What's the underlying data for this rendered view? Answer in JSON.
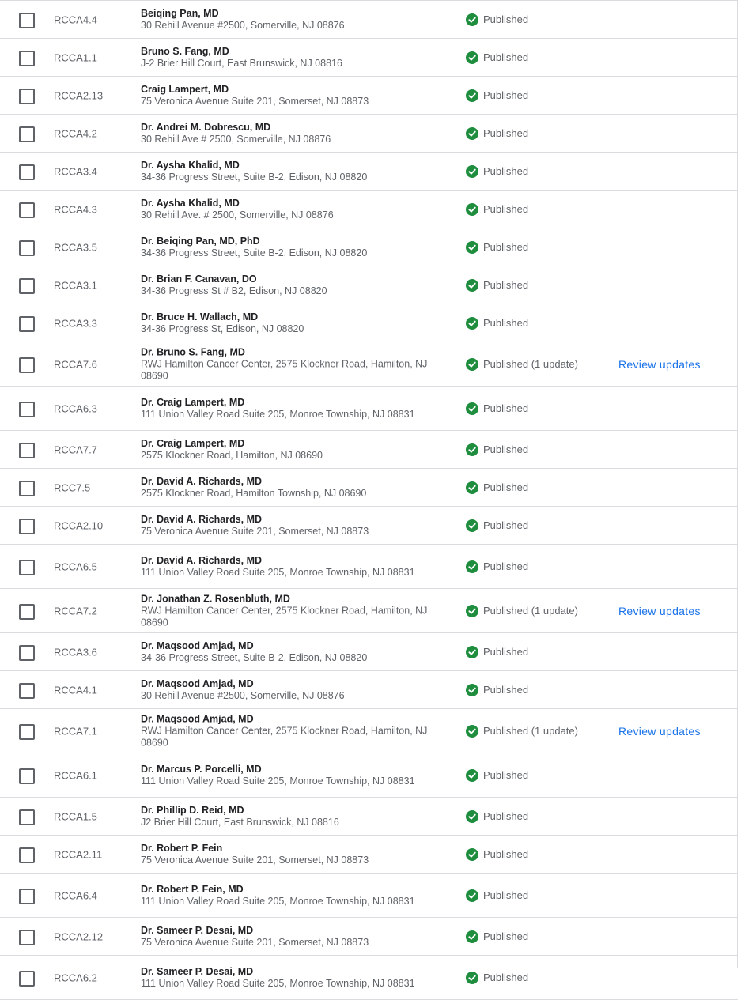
{
  "icons": {
    "checkbox": "checkbox-outline",
    "status": "check-circle-icon"
  },
  "colors": {
    "published_green": "#1e8e3e",
    "link_blue": "#1a73e8",
    "border": "#dadce0"
  },
  "locations": [
    {
      "code": "RCCA4.4",
      "name": "Beiqing Pan, MD",
      "address": "30 Rehill Avenue #2500, Somerville, NJ 08876",
      "status": "Published",
      "action": ""
    },
    {
      "code": "RCCA1.1",
      "name": "Bruno S. Fang, MD",
      "address": "J-2 Brier Hill Court, East Brunswick, NJ 08816",
      "status": "Published",
      "action": ""
    },
    {
      "code": "RCCA2.13",
      "name": "Craig Lampert, MD",
      "address": "75 Veronica Avenue Suite 201, Somerset, NJ 08873",
      "status": "Published",
      "action": ""
    },
    {
      "code": "RCCA4.2",
      "name": "Dr. Andrei M. Dobrescu, MD",
      "address": "30 Rehill Ave # 2500, Somerville, NJ 08876",
      "status": "Published",
      "action": ""
    },
    {
      "code": "RCCA3.4",
      "name": "Dr. Aysha Khalid, MD",
      "address": "34-36 Progress Street, Suite B-2, Edison, NJ 08820",
      "status": "Published",
      "action": ""
    },
    {
      "code": "RCCA4.3",
      "name": "Dr. Aysha Khalid, MD",
      "address": "30 Rehill Ave. # 2500, Somerville, NJ 08876",
      "status": "Published",
      "action": ""
    },
    {
      "code": "RCCA3.5",
      "name": "Dr. Beiqing Pan, MD, PhD",
      "address": "34-36 Progress Street, Suite B-2, Edison, NJ 08820",
      "status": "Published",
      "action": ""
    },
    {
      "code": "RCCA3.1",
      "name": "Dr. Brian F. Canavan, DO",
      "address": "34-36 Progress St # B2, Edison, NJ 08820",
      "status": "Published",
      "action": ""
    },
    {
      "code": "RCCA3.3",
      "name": "Dr. Bruce H. Wallach, MD",
      "address": "34-36 Progress St, Edison, NJ 08820",
      "status": "Published",
      "action": ""
    },
    {
      "code": "RCCA7.6",
      "name": "Dr. Bruno S. Fang, MD",
      "address": "RWJ Hamilton Cancer Center, 2575 Klockner Road, Hamilton, NJ 08690",
      "status": "Published (1 update)",
      "action": "Review updates"
    },
    {
      "code": "RCCA6.3",
      "name": "Dr. Craig Lampert, MD",
      "address": "111 Union Valley Road Suite 205, Monroe Township, NJ 08831",
      "status": "Published",
      "action": ""
    },
    {
      "code": "RCCA7.7",
      "name": "Dr. Craig Lampert, MD",
      "address": "2575 Klockner Road, Hamilton, NJ 08690",
      "status": "Published",
      "action": ""
    },
    {
      "code": "RCC7.5",
      "name": "Dr. David A. Richards, MD",
      "address": "2575 Klockner Road, Hamilton Township, NJ 08690",
      "status": "Published",
      "action": ""
    },
    {
      "code": "RCCA2.10",
      "name": "Dr. David A. Richards, MD",
      "address": "75 Veronica Avenue Suite 201, Somerset, NJ 08873",
      "status": "Published",
      "action": ""
    },
    {
      "code": "RCCA6.5",
      "name": "Dr. David A. Richards, MD",
      "address": "111 Union Valley Road Suite 205, Monroe Township, NJ 08831",
      "status": "Published",
      "action": ""
    },
    {
      "code": "RCCA7.2",
      "name": "Dr. Jonathan Z. Rosenbluth, MD",
      "address": "RWJ Hamilton Cancer Center, 2575 Klockner Road, Hamilton, NJ 08690",
      "status": "Published (1 update)",
      "action": "Review updates"
    },
    {
      "code": "RCCA3.6",
      "name": "Dr. Maqsood Amjad, MD",
      "address": "34-36 Progress Street, Suite B-2, Edison, NJ 08820",
      "status": "Published",
      "action": ""
    },
    {
      "code": "RCCA4.1",
      "name": "Dr. Maqsood Amjad, MD",
      "address": "30 Rehill Avenue #2500, Somerville, NJ 08876",
      "status": "Published",
      "action": ""
    },
    {
      "code": "RCCA7.1",
      "name": "Dr. Maqsood Amjad, MD",
      "address": "RWJ Hamilton Cancer Center, 2575 Klockner Road, Hamilton, NJ 08690",
      "status": "Published (1 update)",
      "action": "Review updates"
    },
    {
      "code": "RCCA6.1",
      "name": "Dr. Marcus P. Porcelli, MD",
      "address": "111 Union Valley Road Suite 205, Monroe Township, NJ 08831",
      "status": "Published",
      "action": ""
    },
    {
      "code": "RCCA1.5",
      "name": "Dr. Phillip D. Reid, MD",
      "address": "J2 Brier Hill Court, East Brunswick, NJ 08816",
      "status": "Published",
      "action": ""
    },
    {
      "code": "RCCA2.11",
      "name": "Dr. Robert P. Fein",
      "address": "75 Veronica Avenue Suite 201, Somerset, NJ 08873",
      "status": "Published",
      "action": ""
    },
    {
      "code": "RCCA6.4",
      "name": "Dr. Robert P. Fein, MD",
      "address": "111 Union Valley Road Suite 205, Monroe Township, NJ 08831",
      "status": "Published",
      "action": ""
    },
    {
      "code": "RCCA2.12",
      "name": "Dr. Sameer P. Desai, MD",
      "address": "75 Veronica Avenue Suite 201, Somerset, NJ 08873",
      "status": "Published",
      "action": ""
    },
    {
      "code": "RCCA6.2",
      "name": "Dr. Sameer P. Desai, MD",
      "address": "111 Union Valley Road Suite 205, Monroe Township, NJ 08831",
      "status": "Published",
      "action": ""
    }
  ]
}
